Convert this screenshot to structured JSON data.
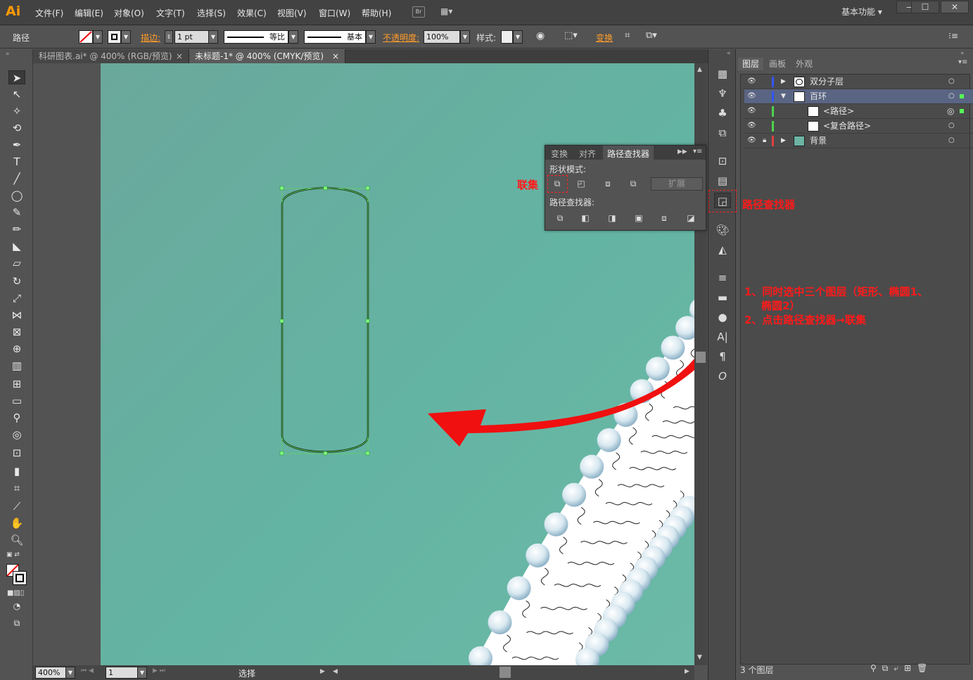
{
  "app": {
    "logo": "Ai",
    "workspace": "基本功能 ▾",
    "accent": "#ff9a00"
  },
  "menu": [
    "文件(F)",
    "编辑(E)",
    "对象(O)",
    "文字(T)",
    "选择(S)",
    "效果(C)",
    "视图(V)",
    "窗口(W)",
    "帮助(H)"
  ],
  "menu_extra": {
    "bridge": "Br"
  },
  "window_buttons": [
    "—",
    "☐",
    "✕"
  ],
  "control": {
    "object_type": "路径",
    "stroke_label": "描边:",
    "stroke_weight": "1 pt",
    "profile_label": "等比",
    "brush_label": "基本",
    "opacity_label": "不透明度:",
    "opacity_value": "100%",
    "style_label": "样式:",
    "transform_label": "变换"
  },
  "tabs": [
    {
      "label": "科研图表.ai* @ 400% (RGB/预览)",
      "close": "×"
    },
    {
      "label": "未标题-1* @ 400% (CMYK/预览)",
      "close": "×"
    }
  ],
  "status": {
    "zoom": "400%",
    "page": "1",
    "tool": "选择"
  },
  "pathfinder": {
    "tabs": [
      "变换",
      "对齐",
      "路径查找器"
    ],
    "shape_modes_label": "形状模式:",
    "pathfinders_label": "路径查找器:",
    "expand_label": "扩展"
  },
  "layers_panel": {
    "tabs": [
      "图层",
      "画板",
      "外观"
    ],
    "rows": [
      {
        "name": "双分子层",
        "color": "#3355ff"
      },
      {
        "name": "百环",
        "color": "#3355ff"
      },
      {
        "name": "<路径>",
        "color": "#4fd24f"
      },
      {
        "name": "<复合路径>",
        "color": "#4fd24f"
      },
      {
        "name": "背景",
        "color": "#e04040"
      }
    ],
    "footer": "3 个图层"
  },
  "annotations": {
    "union": "联集",
    "pathfinder": "路径查找器",
    "step1": "1、同时选中三个图层（矩形、椭圆1、",
    "step1b": "椭圆2）",
    "step2": "2、点击路径查找器→联集"
  }
}
